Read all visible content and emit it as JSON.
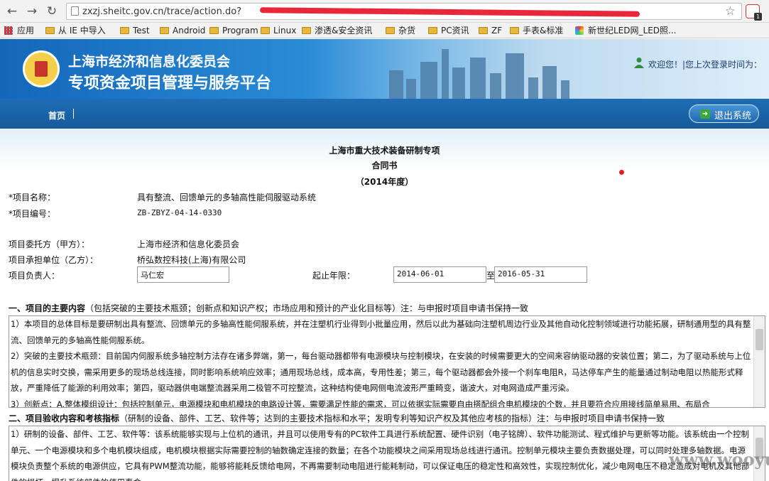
{
  "browser": {
    "url": "zxzj.sheitc.gov.cn/trace/action.do?",
    "bookmarks": [
      "应用",
      "从 IE 中导入",
      "Test",
      "Android",
      "Program",
      "Linux",
      "渗透&安全资讯",
      "杂货",
      "PC资讯",
      "ZF",
      "手表&标准",
      "新世纪LED网_LED照..."
    ]
  },
  "header": {
    "org": "上海市经济和信息化委员会",
    "platform": "专项资金项目管理与服务平台",
    "welcome": "欢迎您！|您上次登录时间为："
  },
  "nav": {
    "home": "首页",
    "logout": "退出系统"
  },
  "doc": {
    "title1": "上海市重大技术装备研制专项",
    "title2": "合同书",
    "year": "（2014年度）",
    "name_label": "*项目名称：",
    "name_value": "具有整流、回馈单元的多轴高性能伺服驱动系统",
    "code_label": "*项目编号：",
    "code_value": "ZB-ZBYZ-04-14-0330",
    "client_label": "项目委托方（甲方）：",
    "client_value": "上海市经济和信息化委员会",
    "contractor_label": "项目承担单位（乙方）：",
    "contractor_value": "桥弘数控科技(上海)有限公司",
    "leader_label": "项目负责人：",
    "leader_value": "马仁宏",
    "period_label": "起止年限：",
    "start_date": "2014-06-01",
    "to": "至",
    "end_date": "2016-05-31",
    "sec1_title": "一、项目的主要内容",
    "sec1_note": "（包括突破的主要技术瓶颈；创新点和知识产权；市场应用和预计的产业化目标等）注：与申报时项目申请书保持一致",
    "sec1_p1": "1）本项目的总体目标是要研制出具有整流、回馈单元的多轴高性能伺服系统，并在注塑机行业得到小批量应用，然后以此为基础向注塑机周边行业及其他自动化控制领域进行功能拓展，研制通用型的具有整流、回馈单元的多轴高性能伺服系统。",
    "sec1_p2": "2）突破的主要技术瓶颈：目前国内伺服系统多轴控制方法存在诸多弊端，第一，每台驱动器都带有电源模块与控制模块，在安装的时候需要更大的空间来容纳驱动器的安装位置；第二，为了驱动系统与上位机的信息实时交换，需采用更多的现场总线连接，同时影响系统响应效率；通用现场总线，成本高，专用性差；第三，每个驱动器都会外接一个刹车电阻R，马达停车产生的能量通过制动电阻以热能形式释放，严重降低了能源的利用效率；第四，驱动器供电端整流器采用二极管不可控整流，这种结构使电网侧电流波形严重畸变，谐波大，对电网造成严重污染。",
    "sec1_p3": "3）创新点：A.整体模组设计：包括控制单元，电源模块和电机模块的电路设计等，需要满足性能的需求，可以依据实际需要自由搭配组合电机模块的个数，并且要符合应用接线简单易用、布局合",
    "sec2_title": "二、项目验收内容和考核指标",
    "sec2_note": "（研制的设备、部件、工艺、软件等；达到的主要技术指标和水平；发明专利等知识产权及其他应考核的指标）注：与申报时项目申请书保持一致",
    "sec2_p1": "1）研制的设备、部件、工艺、软件等：该系统能够实现与上位机的通讯，并且可以使用专有的PC软件工具进行系统配置、硬件识别（电子铭牌）、软件功能测试、程式维护与更新等功能。该系统由一个控制单元、一个电源模块和多个电机模块组成，电机模块根据实际需要控制的轴数确定连接的数量；在各个功能模块之间采用现场总线进行通讯。控制单元模块主要负责数据处理，可以同时处理多轴数据。电源模块负责整个系统的电源供应，它具有PWM整流功能，能够将能耗反馈给电网，不再需要制动电阻进行能耗制动，可以保证电压的稳定性和高效性，实现控制优化，减少电网电压不稳定造成对电机及其他部件的损坏，提升系统部件的使用寿命。"
  },
  "watermark": "www.wooyun.org"
}
